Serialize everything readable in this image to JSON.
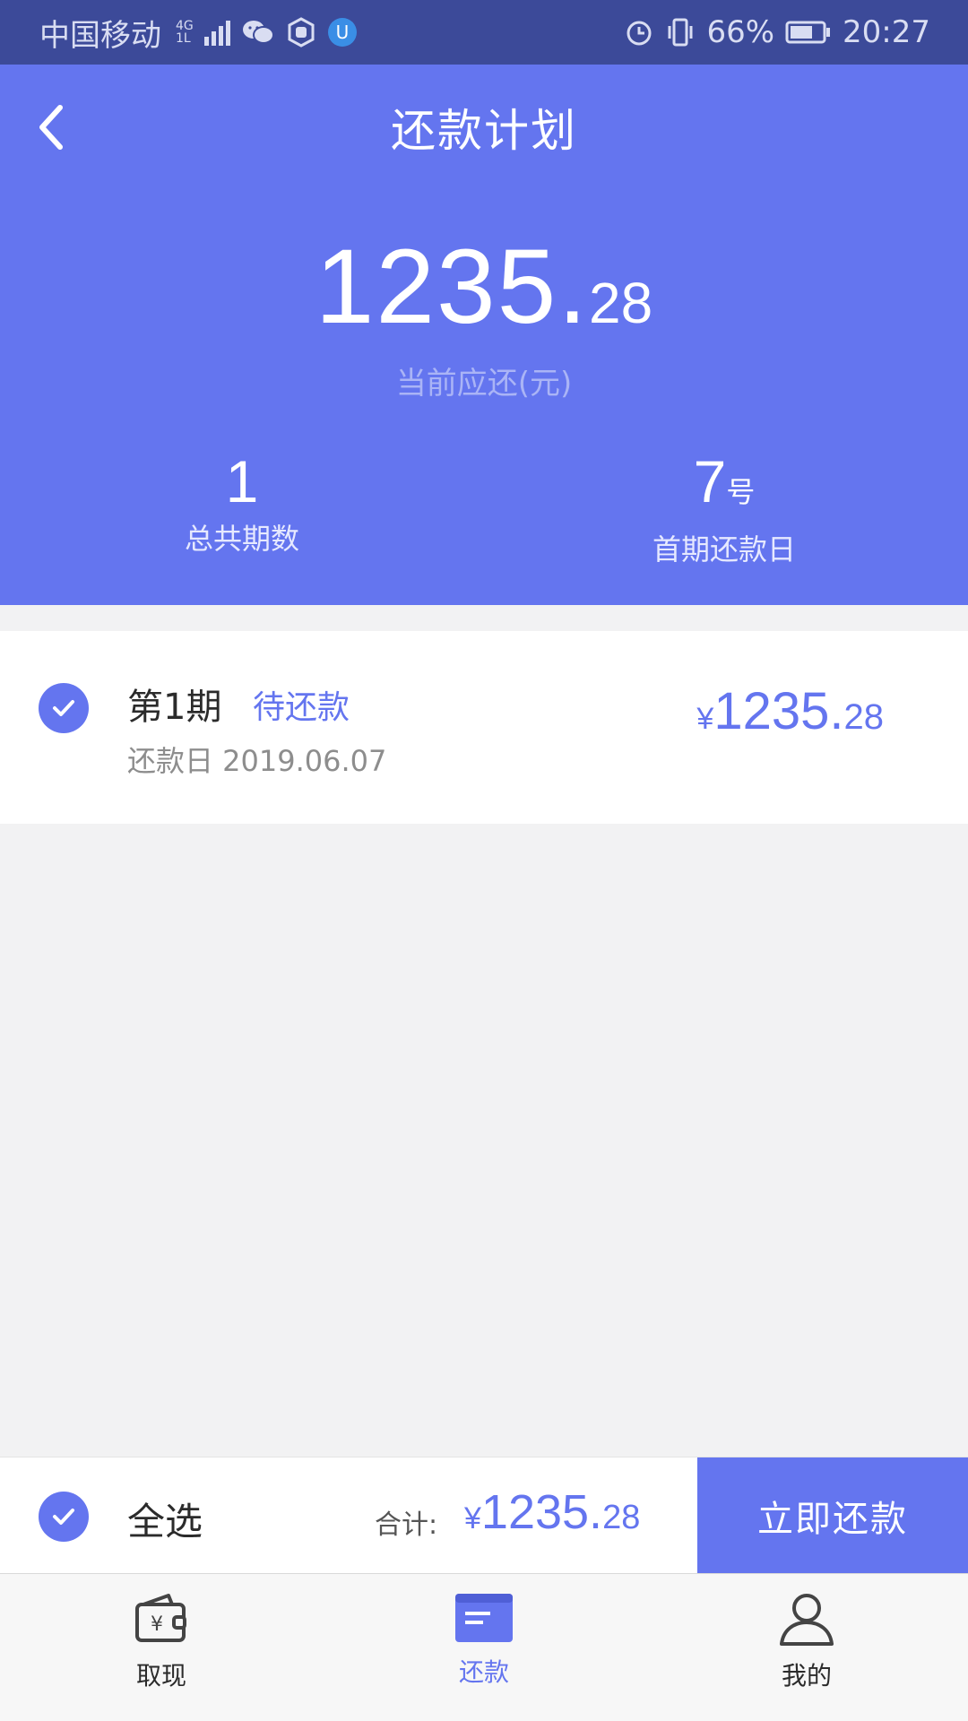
{
  "status_bar": {
    "carrier": "中国移动",
    "network": "4G",
    "network_sub": "1L",
    "battery": "66%",
    "time": "20:27",
    "icons": [
      "signal-icon",
      "wechat-icon",
      "hand-icon",
      "app-icon",
      "alarm-icon",
      "vibrate-icon",
      "battery-icon"
    ]
  },
  "header": {
    "title": "还款计划",
    "amount_int": "1235.",
    "amount_dec": "28",
    "amount_label": "当前应还(元)",
    "total_periods": "1",
    "total_periods_label": "总共期数",
    "first_due_day": "7",
    "first_due_day_unit": "号",
    "first_due_day_label": "首期还款日"
  },
  "installment": {
    "title": "第1期",
    "status": "待还款",
    "date": "还款日 2019.06.07",
    "currency": "¥",
    "amount_int": "1235.",
    "amount_dec": "28"
  },
  "action_bar": {
    "select_all": "全选",
    "total_label": "合计:",
    "currency": "¥",
    "total_int": "1235.",
    "total_dec": "28",
    "pay_button": "立即还款"
  },
  "tabs": [
    {
      "label": "取现"
    },
    {
      "label": "还款"
    },
    {
      "label": "我的"
    }
  ],
  "colors": {
    "accent": "#6475ef",
    "status_bar": "#3c4a99",
    "background": "#f2f2f3"
  }
}
